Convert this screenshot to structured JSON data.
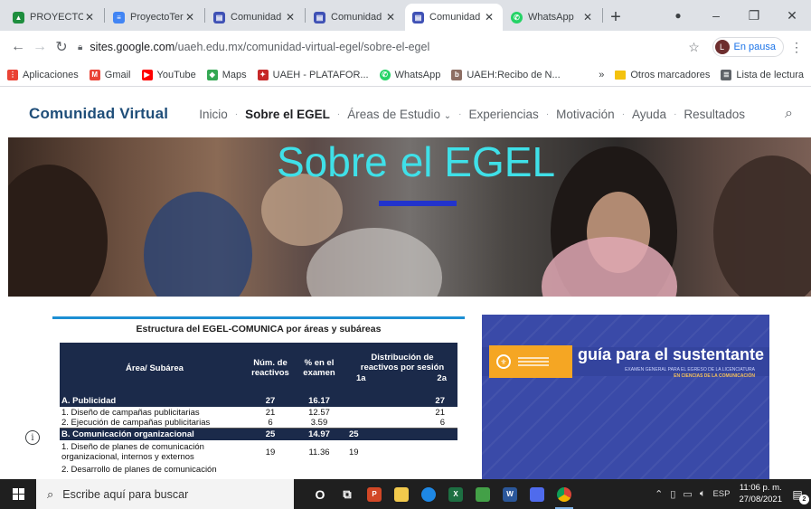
{
  "browser": {
    "tabs": [
      {
        "title": "PROYECTO TE",
        "icon": "drive-icon",
        "color": "#1e8e3e"
      },
      {
        "title": "ProyectoTerm",
        "icon": "forms-icon",
        "color": "#4285f4"
      },
      {
        "title": "Comunidad v",
        "icon": "sites-icon",
        "color": "#3f51b5"
      },
      {
        "title": "Comunidad V",
        "icon": "sites-icon",
        "color": "#3f51b5"
      },
      {
        "title": "Comunidad V",
        "icon": "sites-icon",
        "color": "#3f51b5",
        "active": true
      },
      {
        "title": "WhatsApp",
        "icon": "whatsapp-icon",
        "color": "#25d366"
      }
    ],
    "url_host": "sites.google.com",
    "url_path": "/uaeh.edu.mx/comunidad-virtual-egel/sobre-el-egel",
    "profile_initial": "L",
    "profile_status": "En pausa",
    "bookmarks": [
      {
        "label": "Aplicaciones",
        "icon": "apps-grid-icon",
        "color": "#ea4335"
      },
      {
        "label": "Gmail",
        "icon": "gmail-icon",
        "color": "#ea4335"
      },
      {
        "label": "YouTube",
        "icon": "youtube-icon",
        "color": "#ff0000"
      },
      {
        "label": "Maps",
        "icon": "maps-icon",
        "color": "#34a853"
      },
      {
        "label": "UAEH - PLATAFOR...",
        "icon": "uaeh-icon",
        "color": "#c62828"
      },
      {
        "label": "WhatsApp",
        "icon": "whatsapp-icon",
        "color": "#25d366"
      },
      {
        "label": "UAEH:Recibo de N...",
        "icon": "uaeh-recibo-icon",
        "color": "#8d6e63"
      }
    ],
    "more_chevron": "»",
    "other_bookmarks": "Otros marcadores",
    "reading_list": "Lista de lectura"
  },
  "site": {
    "title": "Comunidad Virtual",
    "nav": [
      "Inicio",
      "Sobre el EGEL",
      "Áreas de Estudio",
      "Experiencias",
      "Motivación",
      "Ayuda",
      "Resultados"
    ],
    "active_nav": "Sobre el EGEL",
    "hero_title_1": "Sobre",
    "hero_title_2": "el EGEL",
    "hero_title_color": "#3fe0e8",
    "hero_bar_color": "#2233cc"
  },
  "table": {
    "title": "Estructura del EGEL-COMUNICA por áreas y subáreas",
    "headers": {
      "area": "Área/ Subárea",
      "num": "Núm. de reactivos",
      "pct": "% en el examen",
      "dist": "Distribución de reactivos por sesión",
      "s1": "1a",
      "s2": "2a"
    },
    "rows": [
      {
        "kind": "sec",
        "area": "A. Publicidad",
        "num": "27",
        "pct": "16.17",
        "s1": "",
        "s2": "27"
      },
      {
        "kind": "item",
        "area": "1. Diseño de campañas publicitarias",
        "num": "21",
        "pct": "12.57",
        "s1": "",
        "s2": "21"
      },
      {
        "kind": "item",
        "area": "2. Ejecución de campañas publicitarias",
        "num": "6",
        "pct": "3.59",
        "s1": "",
        "s2": "6"
      },
      {
        "kind": "sec",
        "area": "B. Comunicación organizacional",
        "num": "25",
        "pct": "14.97",
        "s1": "25",
        "s2": ""
      },
      {
        "kind": "tall",
        "area": "1. Diseño de planes de comunicación organizacional, internos y externos",
        "num": "19",
        "pct": "11.36",
        "s1": "19",
        "s2": ""
      },
      {
        "kind": "item",
        "area": "2. Desarrollo de planes de comunicación",
        "num": "",
        "pct": "",
        "s1": "",
        "s2": ""
      }
    ],
    "header_color": "#1b2a4a",
    "accent_color": "#1d8fd3"
  },
  "guide": {
    "title": "guía para el sustentante",
    "subtitle_1": "EXAMEN GENERAL PARA EL EGRESO DE LA LICENCIATURA",
    "subtitle_2": "EN CIENCIAS DE LA COMUNICACIÓN",
    "bg_color": "#3a4aa8",
    "tag_color": "#f5a623"
  },
  "taskbar": {
    "search_placeholder": "Escribe aquí para buscar",
    "apps": [
      {
        "icon": "cortana-icon",
        "glyph": "O",
        "color": "#1f1f1f"
      },
      {
        "icon": "task-view-icon",
        "glyph": "⧉",
        "color": "#1f1f1f"
      },
      {
        "icon": "powerpoint-icon",
        "glyph": "P",
        "color": "#d24726"
      },
      {
        "icon": "file-explorer-icon",
        "glyph": "",
        "color": "#f2c94c"
      },
      {
        "icon": "browser-app-icon",
        "glyph": "",
        "color": "#1e88e5"
      },
      {
        "icon": "excel-icon",
        "glyph": "X",
        "color": "#1d6f42"
      },
      {
        "icon": "green-app-icon",
        "glyph": "",
        "color": "#43a047"
      },
      {
        "icon": "word-icon",
        "glyph": "W",
        "color": "#2b579a"
      },
      {
        "icon": "teams-icon",
        "glyph": "",
        "color": "#4f6bed"
      },
      {
        "icon": "chrome-icon",
        "glyph": "",
        "color": "#db4437",
        "active": true
      }
    ],
    "language": "ESP",
    "time": "11:06 p. m.",
    "date": "27/08/2021",
    "notifications": "2"
  }
}
